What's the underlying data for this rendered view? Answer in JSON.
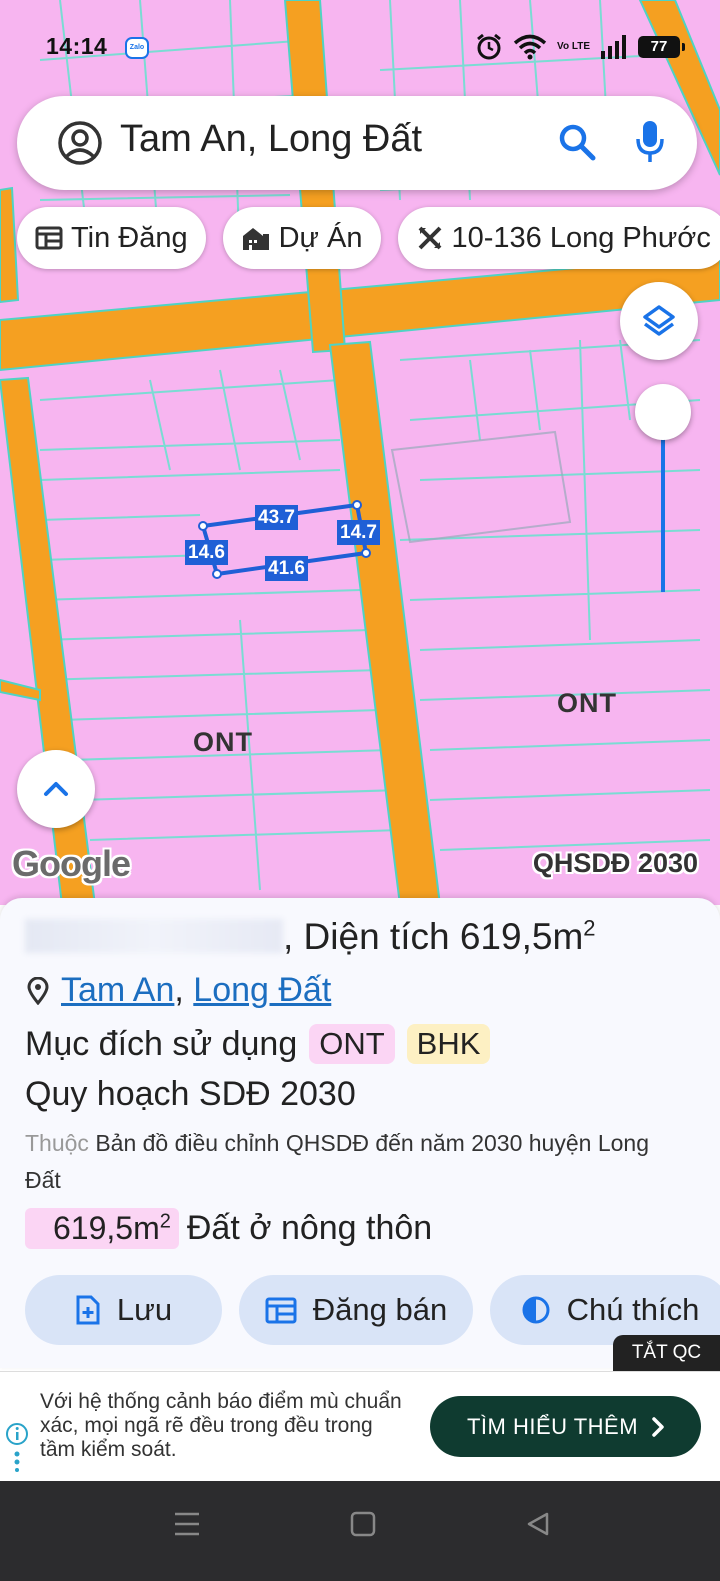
{
  "status_bar": {
    "time": "14:14",
    "zalo_label": "Zalo",
    "network": "Vo LTE",
    "battery": "77"
  },
  "search": {
    "query": "Tam An, Long Đất"
  },
  "chips": [
    {
      "label": "Tin Đăng",
      "icon": "table-icon"
    },
    {
      "label": "Dự Án",
      "icon": "buildings-icon"
    },
    {
      "label": "10-136 Long Phước",
      "icon": "ruler-icon"
    }
  ],
  "map": {
    "dimensions": [
      "43.7",
      "14.7",
      "14.6",
      "41.6"
    ],
    "zone_labels": [
      "ONT",
      "ONT"
    ],
    "attribution": "Google",
    "layer_name": "QHSDĐ 2030",
    "opacity_level": 1.0,
    "colors": {
      "residential": "#f7b5f0",
      "road": "#f5a021",
      "parcel_border": "#6ce0cf",
      "selection": "#1f5fd6"
    }
  },
  "panel": {
    "title_prefix": ", Diện tích ",
    "title_area": "619,5m",
    "title_area_sup": "2",
    "location": [
      "Tam An",
      "Long Đất"
    ],
    "location_sep": ",",
    "purpose_label": "Mục đích sử dụng",
    "purpose_badges": [
      "ONT",
      "BHK"
    ],
    "plan_label": "Quy hoạch SDĐ 2030",
    "desc_prefix": "Thuộc",
    "desc_text": " Bản đồ điều chỉnh QHSDĐ đến năm 2030 huyện Long Đất",
    "area_value": "619,5m",
    "area_sup": "2",
    "area_label": "Đất ở nông thôn",
    "actions": [
      {
        "label": "Lưu",
        "icon": "add-file-icon"
      },
      {
        "label": "Đăng bán",
        "icon": "calendar-icon"
      },
      {
        "label": "Chú thích",
        "icon": "contrast-icon"
      }
    ]
  },
  "ad": {
    "close_label": "TẮT QC",
    "text": "Với hệ thống cảnh báo điểm mù chuẩn xác, mọi ngã rẽ đều trong đều trong tầm kiểm soát.",
    "cta": "TÌM HIỂU THÊM"
  }
}
